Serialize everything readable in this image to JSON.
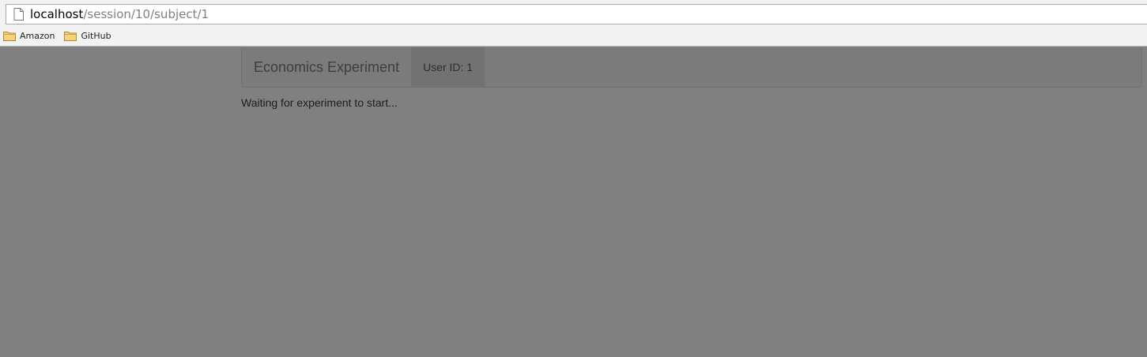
{
  "browser": {
    "url_host": "localhost",
    "url_path": "/session/10/subject/1",
    "bookmarks": [
      {
        "label": "Amazon",
        "icon": "folder-icon"
      },
      {
        "label": "GitHub",
        "icon": "folder-icon"
      }
    ]
  },
  "navbar": {
    "brand": "Economics Experiment",
    "user_id_label": "User ID: 1"
  },
  "main": {
    "status": "Waiting for experiment to start..."
  },
  "colors": {
    "overlay": "#808080",
    "navbar": "#7b7b7b",
    "nav_active": "#727272"
  }
}
